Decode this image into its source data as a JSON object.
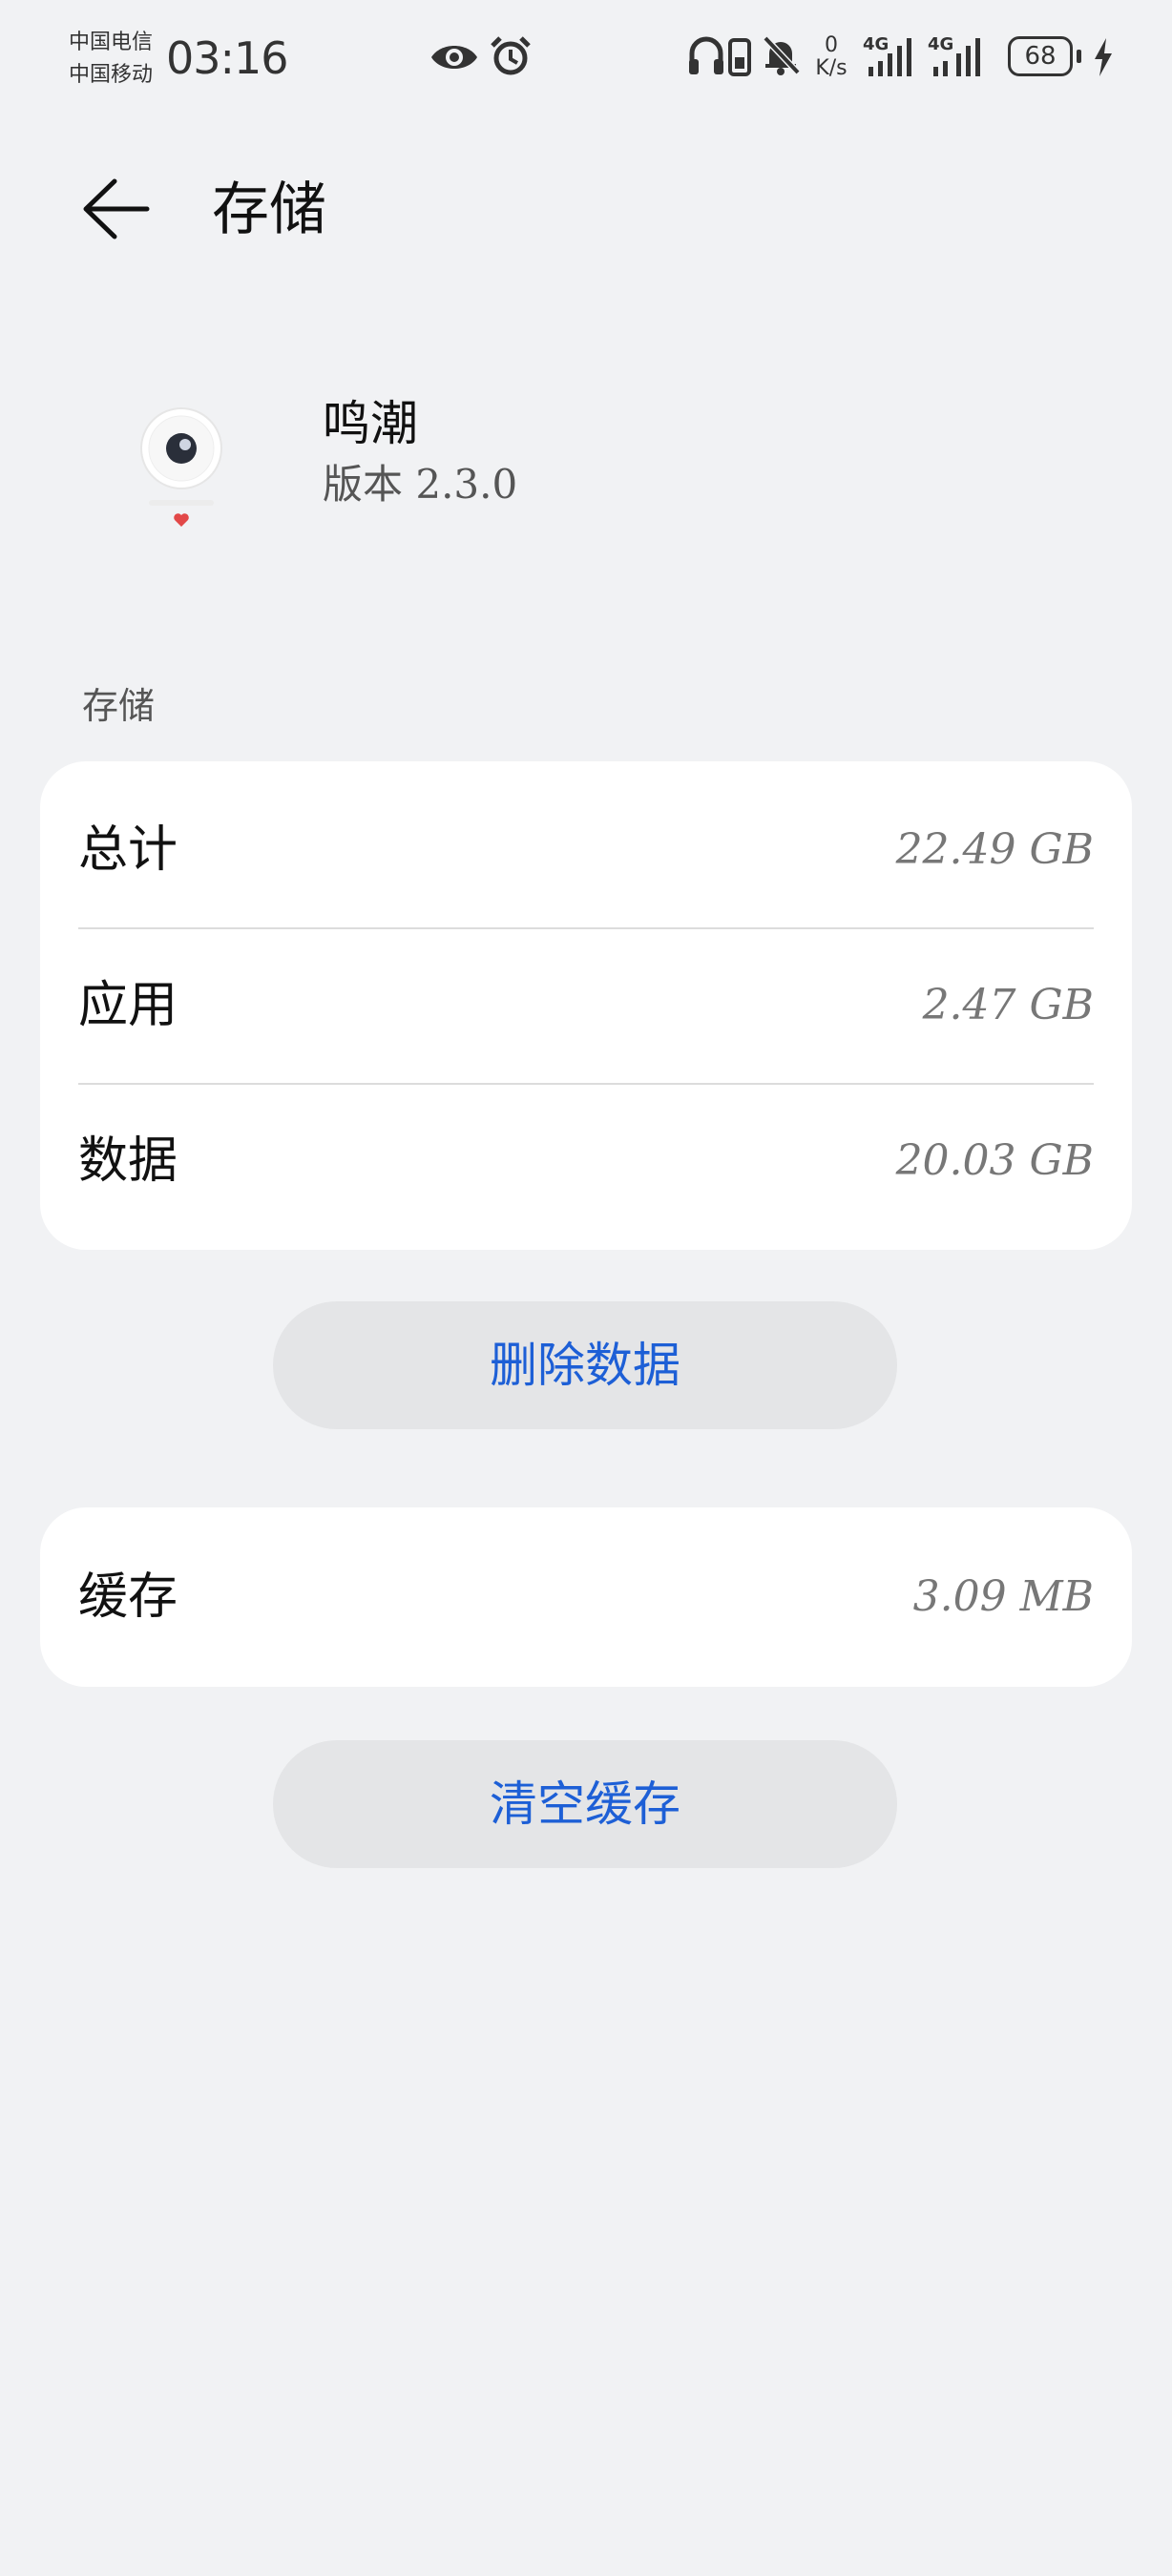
{
  "status_bar": {
    "carrier_1": "中国电信",
    "carrier_2": "中国移动",
    "time": "03:16",
    "net_speed_value": "0",
    "net_speed_unit": "K/s",
    "signal_1_label": "4G",
    "signal_2_label": "4G",
    "battery": "68"
  },
  "header": {
    "title": "存储"
  },
  "app": {
    "name": "鸣潮",
    "version": "版本 2.3.0"
  },
  "storage": {
    "section_label": "存储",
    "rows": [
      {
        "label": "总计",
        "value": "22.49 GB"
      },
      {
        "label": "应用",
        "value": "2.47 GB"
      },
      {
        "label": "数据",
        "value": "20.03 GB"
      }
    ],
    "delete_button": "删除数据"
  },
  "cache": {
    "label": "缓存",
    "value": "3.09 MB",
    "clear_button": "清空缓存"
  },
  "colors": {
    "background": "#f1f2f4",
    "accent": "#1d5fd6",
    "card": "#ffffff",
    "pill": "#e4e5e7"
  }
}
